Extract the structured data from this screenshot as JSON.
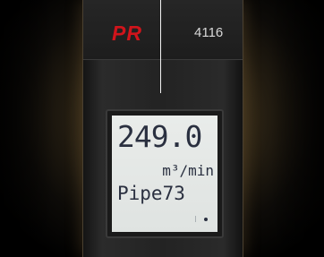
{
  "device": {
    "brand": "PR",
    "model": "4116",
    "brand_color": "#d0141b"
  },
  "display": {
    "value": "249.0",
    "unit": "m³/min",
    "tag": "Pipe73"
  }
}
